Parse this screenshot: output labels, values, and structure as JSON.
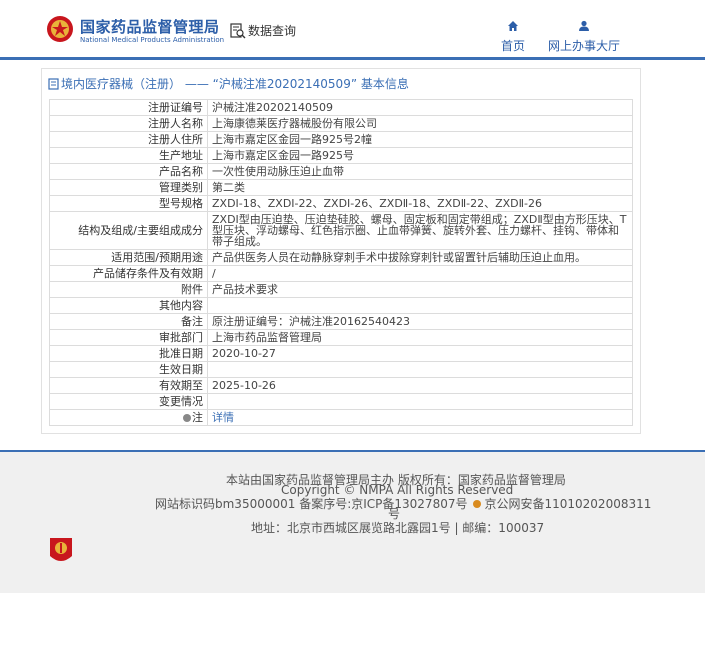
{
  "header": {
    "site_name": "国家药品监督管理局",
    "site_subtitle": "National Medical Products Administration",
    "data_query": "数据查询",
    "nav_home": "首页",
    "nav_hall": "网上办事大厅"
  },
  "breadcrumb": "境内医疗器械（注册） —— “沪械注准20202140509” 基本信息",
  "rows": [
    {
      "label": "注册证编号",
      "value": "沪械注准20202140509"
    },
    {
      "label": "注册人名称",
      "value": "上海康德莱医疗器械股份有限公司"
    },
    {
      "label": "注册人住所",
      "value": "上海市嘉定区金园一路925号2幢"
    },
    {
      "label": "生产地址",
      "value": "上海市嘉定区金园一路925号"
    },
    {
      "label": "产品名称",
      "value": "一次性使用动脉压迫止血带"
    },
    {
      "label": "管理类别",
      "value": "第二类"
    },
    {
      "label": "型号规格",
      "value": "ZXDⅠ-18、ZXDⅠ-22、ZXDⅠ-26、ZXDⅡ-18、ZXDⅡ-22、ZXDⅡ-26"
    },
    {
      "label": "结构及组成/主要组成成分",
      "value": "ZXDⅠ型由压迫垫、压迫垫硅胶、螺母、固定板和固定带组成；ZXDⅡ型由方形压块、T型压块、浮动螺母、红色指示圈、止血带弹簧、旋转外套、压力螺杆、挂钩、带体和带子组成。"
    },
    {
      "label": "适用范围/预期用途",
      "value": "产品供医务人员在动静脉穿刺手术中拔除穿刺针或留置针后辅助压迫止血用。"
    },
    {
      "label": "产品储存条件及有效期",
      "value": "/"
    },
    {
      "label": "附件",
      "value": "产品技术要求"
    },
    {
      "label": "其他内容",
      "value": ""
    },
    {
      "label": "备注",
      "value": "原注册证编号：沪械注准20162540423"
    },
    {
      "label": "审批部门",
      "value": "上海市药品监督管理局"
    },
    {
      "label": "批准日期",
      "value": "2020-10-27"
    },
    {
      "label": "生效日期",
      "value": ""
    },
    {
      "label": "有效期至",
      "value": "2025-10-26"
    },
    {
      "label": "变更情况",
      "value": ""
    }
  ],
  "note_row": {
    "label": "注",
    "link": "详情"
  },
  "footer": {
    "line1": "本站由国家药品监督管理局主办 版权所有：国家药品监督管理局",
    "line2": "Copyright © NMPA All Rights Reserved",
    "line3": "网站标识码bm35000001   备案序号:京ICP备13027807号",
    "line3_police": "京公网安备11010202008311",
    "line3_tail": "号",
    "line4": "地址：北京市西城区展览路北露园1号 | 邮编：100037"
  },
  "colors": {
    "brand_blue": "#2c5ea8",
    "link_blue": "#3b6fb5",
    "logo_red": "#c8161d",
    "footer_bg": "#f0f0f0"
  }
}
